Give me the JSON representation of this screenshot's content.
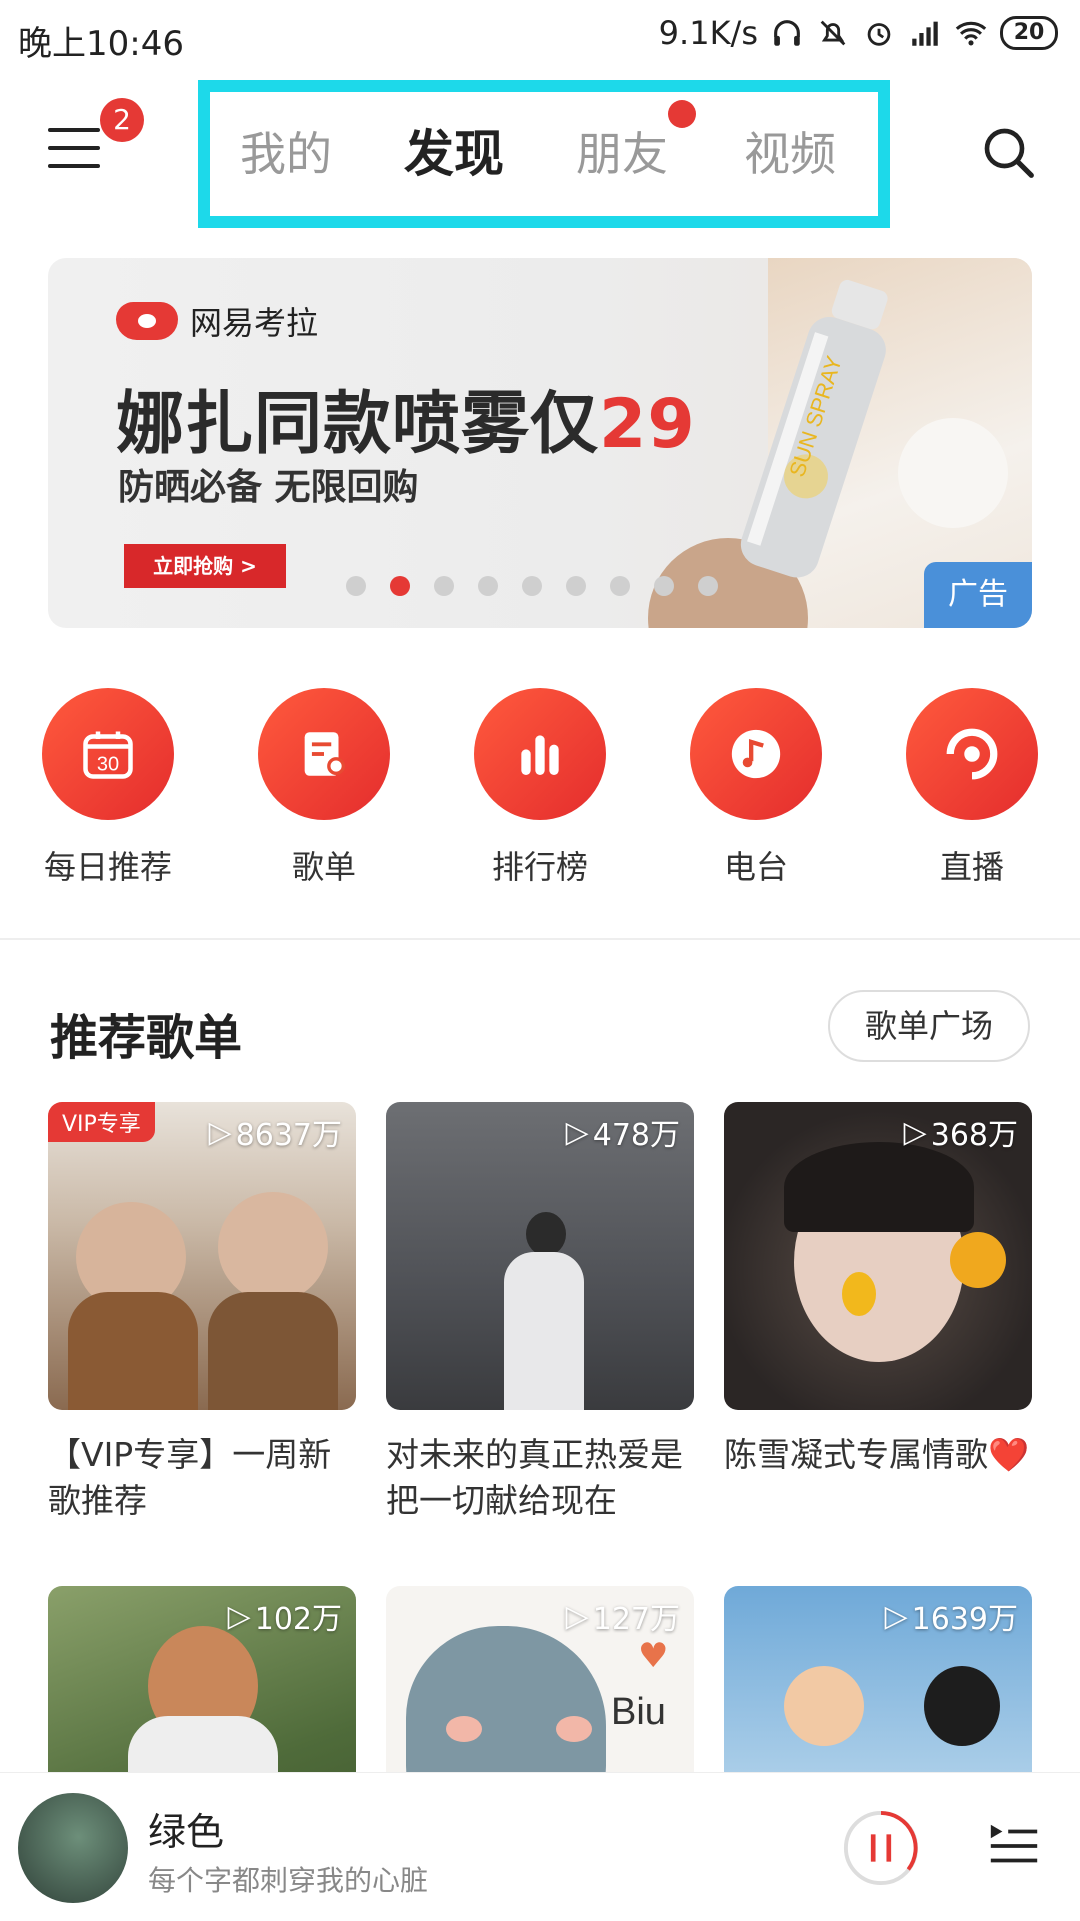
{
  "status_bar": {
    "time": "晚上10:46",
    "speed": "9.1K/s",
    "battery": "20"
  },
  "header": {
    "menu_badge": "2",
    "tabs": [
      {
        "label": "我的"
      },
      {
        "label": "发现"
      },
      {
        "label": "朋友"
      },
      {
        "label": "视频"
      }
    ]
  },
  "banner": {
    "brand": "网易考拉",
    "title": "娜扎同款喷雾仅",
    "title_price": "29",
    "subtitle": "防晒必备 无限回购",
    "cta": "立即抢购 >",
    "ad_tag": "广告",
    "dot_count": 9,
    "active_dot": 1,
    "bottle_text": "SUN SPRAY"
  },
  "entries": [
    {
      "label": "每日推荐",
      "icon": "calendar-icon",
      "day": "30"
    },
    {
      "label": "歌单",
      "icon": "playlist-icon"
    },
    {
      "label": "排行榜",
      "icon": "chart-bars-icon"
    },
    {
      "label": "电台",
      "icon": "radio-icon"
    },
    {
      "label": "直播",
      "icon": "live-icon"
    }
  ],
  "section": {
    "title": "推荐歌单",
    "more_button": "歌单广场"
  },
  "playlists": [
    {
      "play_count": "8637万",
      "vip": "VIP专享",
      "title": "【VIP专享】一周新歌推荐"
    },
    {
      "play_count": "478万",
      "title": "对未来的真正热爱是把一切献给现在"
    },
    {
      "play_count": "368万",
      "title": "陈雪凝式专属情歌❤️"
    },
    {
      "play_count": "102万"
    },
    {
      "play_count": "127万",
      "cover_text": "Biu"
    },
    {
      "play_count": "1639万"
    }
  ],
  "player": {
    "song": "绿色",
    "lyric": "每个字都刺穿我的心脏"
  },
  "colors": {
    "accent": "#e53935",
    "highlight_box": "#1dd9ea",
    "ad_blue": "#4a90d9"
  }
}
